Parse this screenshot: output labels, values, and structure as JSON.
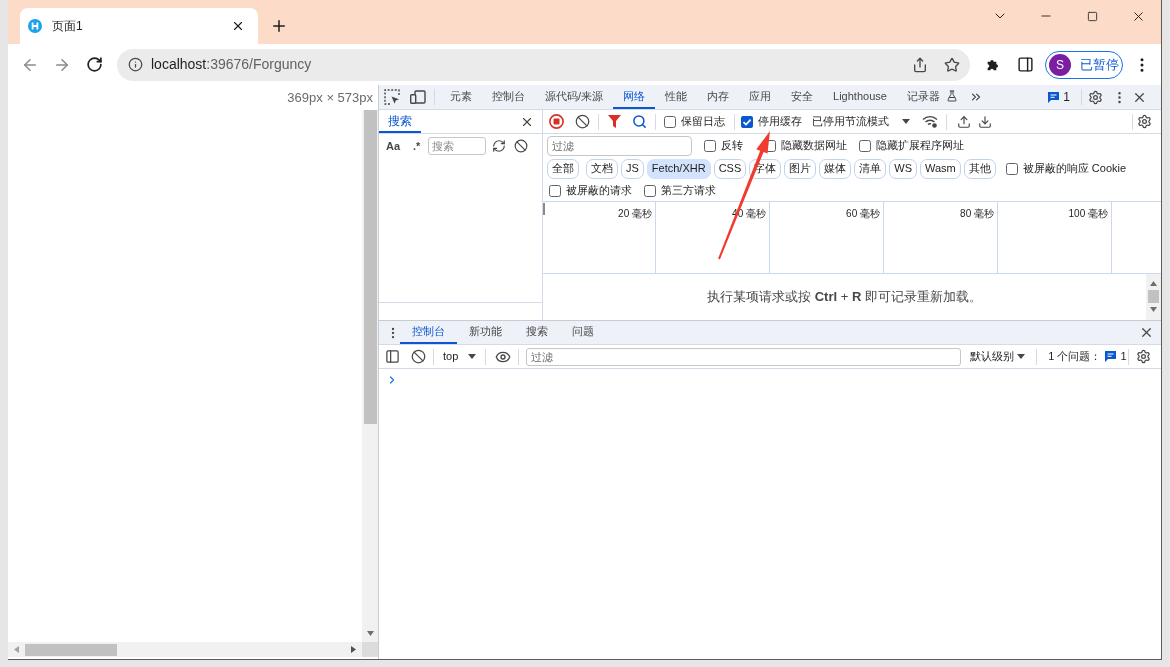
{
  "browser_tab": {
    "title": "页面1"
  },
  "address_bar": {
    "host": "localhost",
    "path": ":39676/Forguncy"
  },
  "profile": {
    "initial": "S",
    "status": "已暂停"
  },
  "viewport": {
    "size": "369px × 573px"
  },
  "devtools": {
    "panel_tabs": [
      {
        "label": "元素",
        "selected": false,
        "experimental": false
      },
      {
        "label": "控制台",
        "selected": false,
        "experimental": false
      },
      {
        "label": "源代码/来源",
        "selected": false,
        "experimental": false
      },
      {
        "label": "网络",
        "selected": true,
        "experimental": false
      },
      {
        "label": "性能",
        "selected": false,
        "experimental": false
      },
      {
        "label": "内存",
        "selected": false,
        "experimental": false
      },
      {
        "label": "应用",
        "selected": false,
        "experimental": false
      },
      {
        "label": "安全",
        "selected": false,
        "experimental": false
      },
      {
        "label": "Lighthouse",
        "selected": false,
        "experimental": false
      },
      {
        "label": "记录器",
        "selected": false,
        "experimental": true
      }
    ],
    "issues_badge": "1",
    "search_pane": {
      "tab": "搜索",
      "match_case": "Aa",
      "regex": ".*",
      "placeholder": "搜索"
    },
    "network": {
      "toolbar_checkboxes": [
        {
          "label": "保留日志",
          "checked": false
        },
        {
          "label": "停用缓存",
          "checked": true
        }
      ],
      "throttling": "已停用节流模式",
      "filter": {
        "placeholder": "过滤"
      },
      "filter_checkboxes": [
        {
          "label": "反转",
          "checked": false
        },
        {
          "label": "隐藏数据网址",
          "checked": false
        },
        {
          "label": "隐藏扩展程序网址",
          "checked": false
        }
      ],
      "type_filters": [
        {
          "label": "全部",
          "selected": false
        },
        {
          "label": "文档",
          "selected": false
        },
        {
          "label": "JS",
          "selected": false
        },
        {
          "label": "Fetch/XHR",
          "selected": true
        },
        {
          "label": "CSS",
          "selected": false
        },
        {
          "label": "字体",
          "selected": false
        },
        {
          "label": "图片",
          "selected": false
        },
        {
          "label": "媒体",
          "selected": false
        },
        {
          "label": "清单",
          "selected": false
        },
        {
          "label": "WS",
          "selected": false
        },
        {
          "label": "Wasm",
          "selected": false
        },
        {
          "label": "其他",
          "selected": false
        }
      ],
      "cookie_checkbox": {
        "label": "被屏蔽的响应 Cookie",
        "checked": false
      },
      "request_checkboxes": [
        {
          "label": "被屏蔽的请求",
          "checked": false
        },
        {
          "label": "第三方请求",
          "checked": false
        }
      ],
      "timeline_ticks": [
        "20 毫秒",
        "40 毫秒",
        "60 毫秒",
        "80 毫秒",
        "100 毫秒"
      ],
      "hint": "执行某项请求或按 **Ctrl** + **R** 即可记录重新加载。"
    },
    "drawer": {
      "tabs": [
        {
          "label": "控制台",
          "selected": true
        },
        {
          "label": "新功能",
          "selected": false
        },
        {
          "label": "搜索",
          "selected": false
        },
        {
          "label": "问题",
          "selected": false
        }
      ],
      "context": "top",
      "filter": {
        "placeholder": "过滤"
      },
      "log_level": "默认级别",
      "issues_label": "1 个问题：",
      "issues_count": "1"
    }
  }
}
